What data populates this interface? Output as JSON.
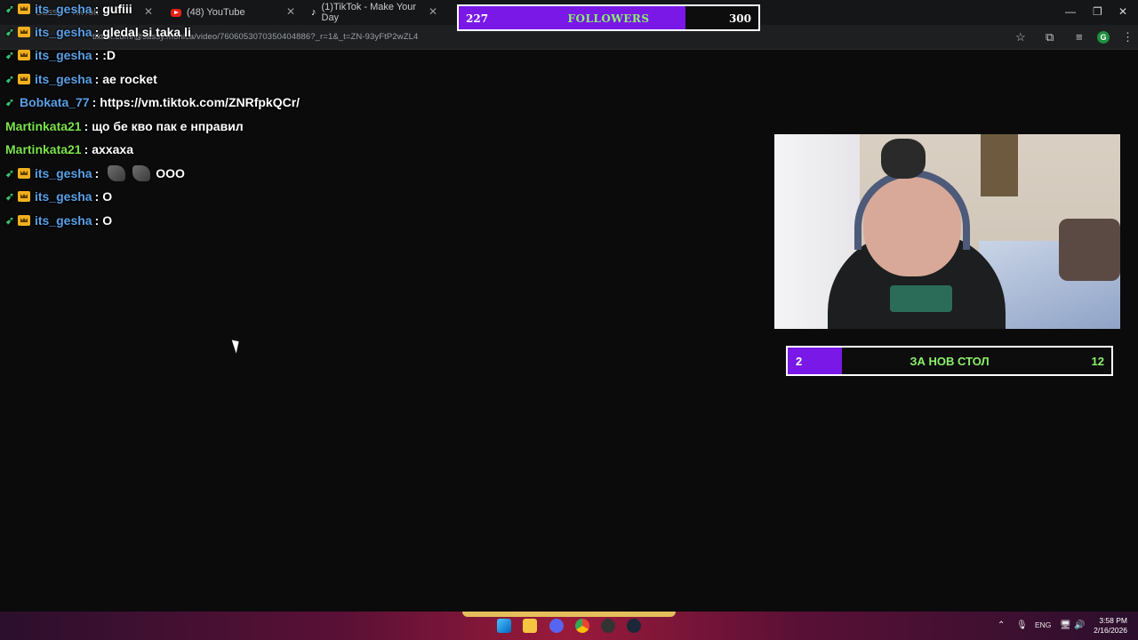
{
  "browser": {
    "tabs": [
      {
        "label": "Sassy - TikTok"
      },
      {
        "label": "(48) YouTube"
      },
      {
        "label": "(1)TikTok - Make Your Day"
      }
    ],
    "url": "tiktok.com/@sassy.monica/video/7606053070350404886?_r=1&_t=ZN-93yFtP2wZL4",
    "profile_initial": "G"
  },
  "chat": {
    "messages": [
      {
        "user": "its_gesha",
        "text": "gufiii",
        "color": "#5aa0e6",
        "badges": true
      },
      {
        "user": "its_gesha",
        "text": "gledal si taka li",
        "color": "#5aa0e6",
        "badges": true
      },
      {
        "user": "its_gesha",
        "text": ":D",
        "color": "#5aa0e6",
        "badges": true
      },
      {
        "user": "its_gesha",
        "text": "ae rocket",
        "color": "#5aa0e6",
        "badges": true
      },
      {
        "user": "Bobkata_77",
        "text": "https://vm.tiktok.com/ZNRfpkQCr/",
        "color": "#5aa0e6",
        "badges": "arrow"
      },
      {
        "user": "Martinkata21",
        "text": "що бе кво пак е нправил",
        "color": "#7be34a",
        "badges": false
      },
      {
        "user": "Martinkata21",
        "text": "аххаха",
        "color": "#7be34a",
        "badges": false
      },
      {
        "user": "its_gesha",
        "text": "OOO",
        "color": "#5aa0e6",
        "badges": true,
        "emotes": 2
      },
      {
        "user": "its_gesha",
        "text": "O",
        "color": "#5aa0e6",
        "badges": true
      },
      {
        "user": "its_gesha",
        "text": "O",
        "color": "#5aa0e6",
        "badges": true
      }
    ]
  },
  "followers_goal": {
    "current": "227",
    "title": "FOLLOWERS",
    "target": "300",
    "progress": 0.757
  },
  "table_goal": {
    "current": "2",
    "title": "ЗА НОВ СТОЛ",
    "target": "12",
    "progress": 0.167
  },
  "taskbar": {
    "language": "ENG",
    "time": "3:58 PM",
    "date": "2/16/2026"
  },
  "colors": {
    "accent_purple": "#7a18e8",
    "goal_text_green": "#8bf06a",
    "user_blue": "#5aa0e6",
    "user_green": "#7be34a"
  }
}
